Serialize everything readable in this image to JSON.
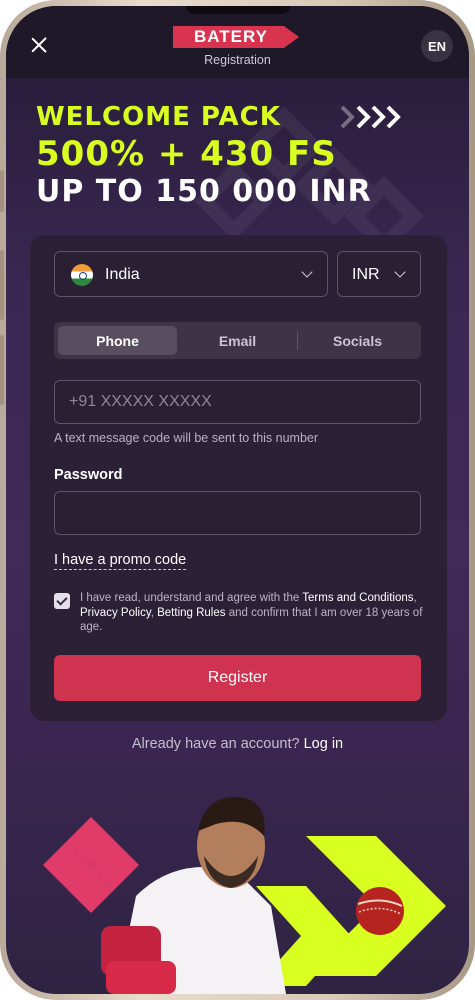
{
  "header": {
    "logo_text": "BATERY",
    "subtitle": "Registration",
    "language": "EN"
  },
  "banner": {
    "line1": "WELCOME PACK",
    "line2": "500% + 430 FS",
    "line3": "UP TO 150 000 INR"
  },
  "form": {
    "country": "India",
    "currency": "INR",
    "tabs": [
      {
        "label": "Phone",
        "active": true
      },
      {
        "label": "Email",
        "active": false
      },
      {
        "label": "Socials",
        "active": false
      }
    ],
    "phone_placeholder": "+91 XXXXX XXXXX",
    "phone_hint": "A text message code will be sent to this number",
    "password_label": "Password",
    "password_value": "",
    "promo_link": "I have a promo code",
    "agree_checked": true,
    "terms": {
      "part1": "I have read, understand and agree with the ",
      "terms_link": "Terms and Conditions",
      "sep1": ", ",
      "privacy_link": "Privacy Policy",
      "sep2": ", ",
      "rules_link": "Betting Rules",
      "part2": " and confirm that I am over 18 years of age."
    },
    "register_label": "Register"
  },
  "footer": {
    "already_text": "Already have an account?",
    "login_label": "Log in"
  },
  "colors": {
    "accent": "#cf3350",
    "promo_yellow": "#d9ff20",
    "background": "#3a2752"
  }
}
